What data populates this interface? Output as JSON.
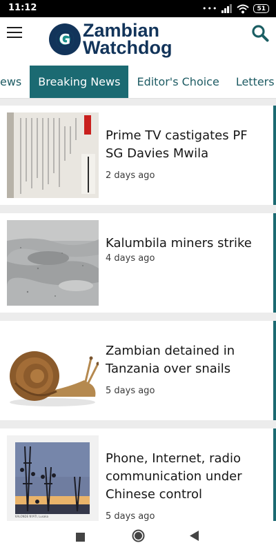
{
  "status_bar": {
    "time": "11:12",
    "battery": "51",
    "signal_dots": "•••"
  },
  "header": {
    "logo_line1": "Zambian",
    "logo_line2": "Watchdog",
    "logo_mark": "G",
    "menu_icon": "hamburger-menu-icon",
    "search_icon": "search-icon"
  },
  "tabs": [
    {
      "label": "ews",
      "active": false
    },
    {
      "label": "Breaking News",
      "active": true
    },
    {
      "label": "Editor's Choice",
      "active": false
    },
    {
      "label": "Letters to",
      "active": false
    }
  ],
  "articles": [
    {
      "title": "Prime TV castigates PF SG Davies Mwila",
      "time": "2 days ago",
      "thumb": "document-photo"
    },
    {
      "title": "Kalumbila miners strike",
      "time": "4 days ago",
      "thumb": "mine-photo"
    },
    {
      "title": "Zambian detained in Tanzania over snails",
      "time": "5 days ago",
      "thumb": "snail-photo"
    },
    {
      "title": "Phone, Internet, radio communication under Chinese control",
      "time": "5 days ago",
      "thumb": "towers-photo",
      "thumb_caption": "KALONDE NYATI, Lusaka"
    }
  ],
  "colors": {
    "accent": "#1b6a72",
    "brand_navy": "#12345a",
    "brand_teal": "#1b8f8a"
  },
  "nav": {
    "recents_icon": "square-icon",
    "home_icon": "circle-icon",
    "back_icon": "triangle-back-icon"
  }
}
